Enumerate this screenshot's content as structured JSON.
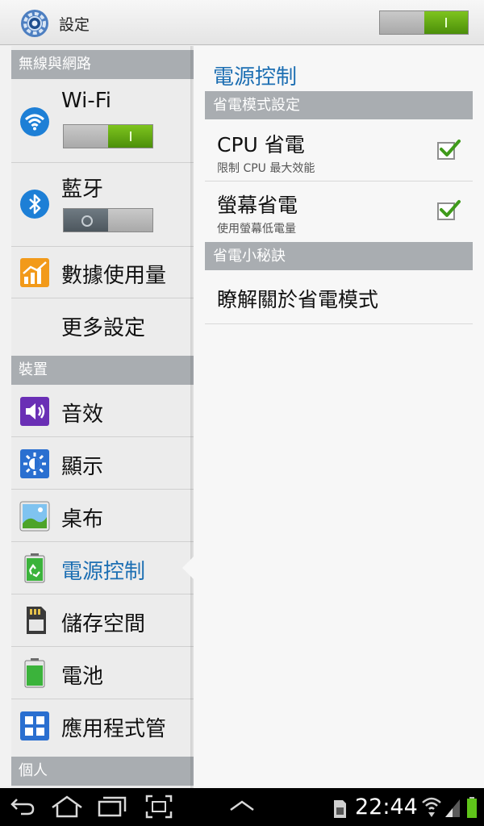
{
  "actionbar": {
    "title": "設定",
    "icon": "settings-gear-icon",
    "master_switch_on": true
  },
  "sidebar": {
    "sections": [
      {
        "header": "無線與網路",
        "items": [
          {
            "label": "Wi-Fi",
            "icon": "wifi-icon",
            "toggle": "on"
          },
          {
            "label": "藍牙",
            "icon": "bluetooth-icon",
            "toggle": "off"
          },
          {
            "label": "數據使用量",
            "icon": "data-usage-icon"
          },
          {
            "label": "更多設定",
            "icon": ""
          }
        ]
      },
      {
        "header": "裝置",
        "items": [
          {
            "label": "音效",
            "icon": "sound-icon"
          },
          {
            "label": "顯示",
            "icon": "display-icon"
          },
          {
            "label": "桌布",
            "icon": "wallpaper-icon"
          },
          {
            "label": "電源控制",
            "icon": "power-saving-icon",
            "active": true
          },
          {
            "label": "儲存空間",
            "icon": "storage-icon"
          },
          {
            "label": "電池",
            "icon": "battery-icon"
          },
          {
            "label": "應用程式管",
            "icon": "apps-icon"
          }
        ]
      },
      {
        "header": "個人",
        "items": []
      }
    ]
  },
  "detail": {
    "title": "電源控制",
    "sections": [
      {
        "header": "省電模式設定",
        "rows": [
          {
            "title": "CPU 省電",
            "summary": "限制 CPU 最大效能",
            "checked": true
          },
          {
            "title": "螢幕省電",
            "summary": "使用螢幕低電量",
            "checked": true
          }
        ]
      },
      {
        "header": "省電小秘訣",
        "rows": [
          {
            "title": "瞭解關於省電模式"
          }
        ]
      }
    ]
  },
  "navbar": {
    "time": "22:44",
    "icons": [
      "back-icon",
      "home-icon",
      "recent-apps-icon",
      "screenshot-icon",
      "up-chevron-icon",
      "sd-card-icon",
      "wifi-signal-icon",
      "cell-signal-icon",
      "battery-status-icon"
    ]
  },
  "colors": {
    "accent": "#1d6fb3",
    "section_header": "#a9adb1",
    "switch_on": "#5fa512"
  }
}
